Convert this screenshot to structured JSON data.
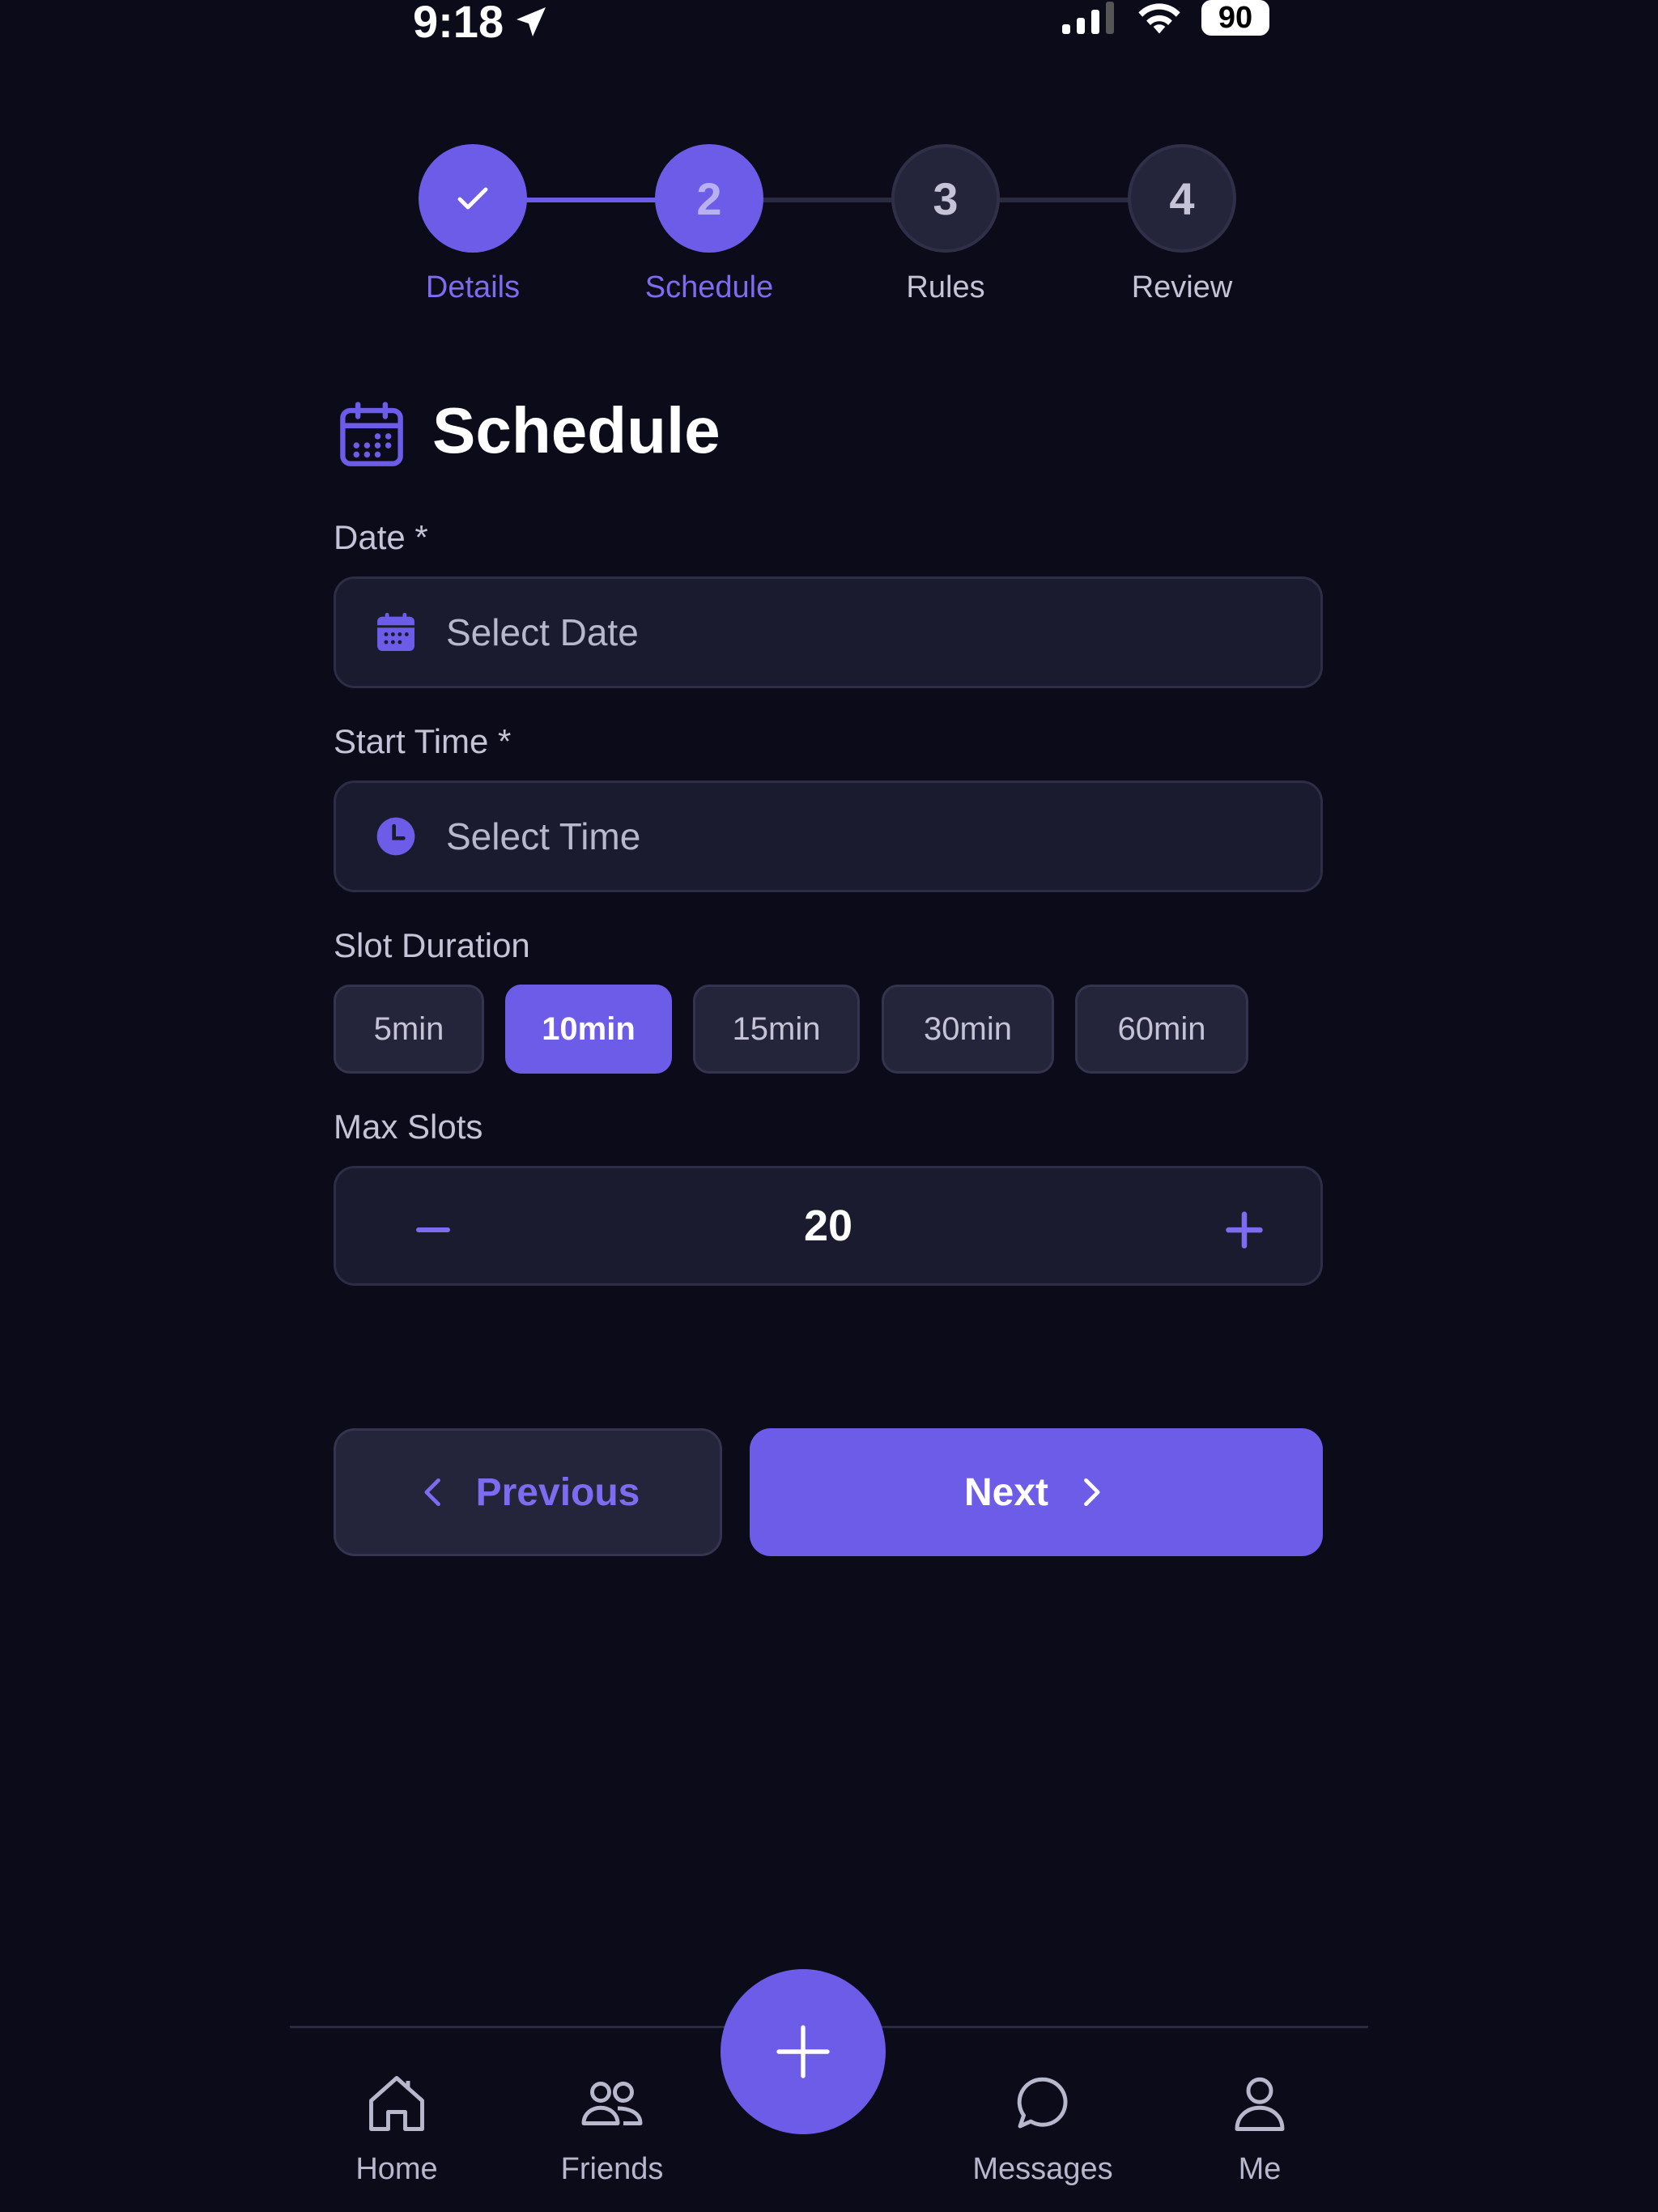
{
  "status_bar": {
    "time": "9:18",
    "battery": "90"
  },
  "stepper": {
    "steps": [
      {
        "number": "",
        "label": "Details",
        "state": "complete"
      },
      {
        "number": "2",
        "label": "Schedule",
        "state": "active"
      },
      {
        "number": "3",
        "label": "Rules",
        "state": "upcoming"
      },
      {
        "number": "4",
        "label": "Review",
        "state": "upcoming"
      }
    ]
  },
  "section": {
    "title": "Schedule",
    "icon": "calendar-icon"
  },
  "form": {
    "date_label": "Date *",
    "date_placeholder": "Select Date",
    "time_label": "Start Time *",
    "time_placeholder": "Select Time",
    "duration_label": "Slot Duration",
    "durations": [
      "5min",
      "10min",
      "15min",
      "30min",
      "60min"
    ],
    "selected_duration": "10min",
    "max_slots_label": "Max Slots",
    "max_slots_value": "20"
  },
  "actions": {
    "previous_label": "Previous",
    "next_label": "Next"
  },
  "bottom_nav": {
    "items": [
      {
        "label": "Home",
        "icon": "home-icon"
      },
      {
        "label": "Friends",
        "icon": "friends-icon"
      },
      {
        "label": "Messages",
        "icon": "messages-icon"
      },
      {
        "label": "Me",
        "icon": "profile-icon"
      }
    ],
    "fab_icon": "plus-icon"
  },
  "colors": {
    "background": "#0b0b1a",
    "accent": "#6c5ce7",
    "surface": "#1b1b2f",
    "muted_text": "#b8b8cc"
  }
}
